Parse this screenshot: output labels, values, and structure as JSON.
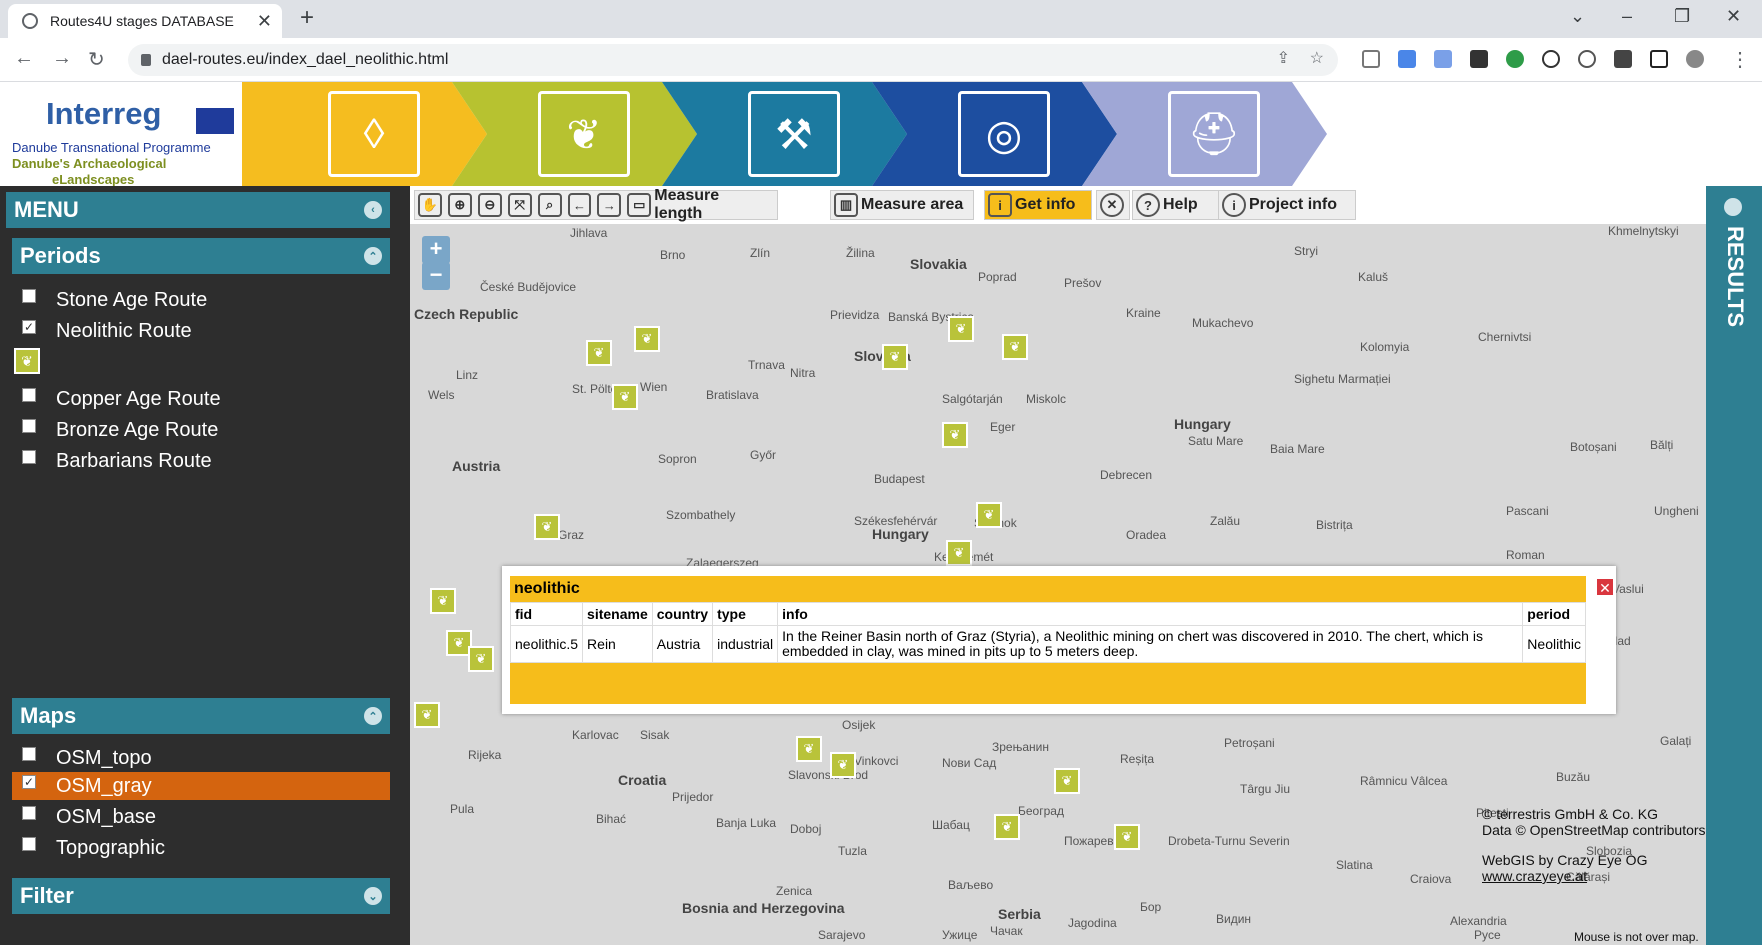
{
  "browser": {
    "tab_title": "Routes4U stages DATABASE",
    "url": "dael-routes.eu/index_dael_neolithic.html"
  },
  "banner": {
    "logo_brand": "Interreg",
    "logo_line1": "Danube Transnational Programme",
    "logo_line2": "Danube's Archaeological",
    "logo_line3": "eLandscapes",
    "chevrons": [
      {
        "icon": "stone-icon",
        "color": "#f5bd1f"
      },
      {
        "icon": "wheat-icon",
        "color": "#b7c230"
      },
      {
        "icon": "axe-icon",
        "color": "#1c7aa0"
      },
      {
        "icon": "spiral-icon",
        "color": "#1d4ea0"
      },
      {
        "icon": "helmet-icon",
        "color": "#9fa7d6"
      }
    ]
  },
  "menu": {
    "title": "MENU",
    "periods": {
      "title": "Periods",
      "items": [
        "Stone Age Route",
        "Neolithic Route",
        "Copper Age Route",
        "Bronze Age Route",
        "Barbarians Route"
      ]
    },
    "maps": {
      "title": "Maps",
      "items": [
        "OSM_topo",
        "OSM_gray",
        "OSM_base",
        "Topographic"
      ]
    },
    "filter_title": "Filter"
  },
  "toolbar": {
    "measure_length": "Measure length",
    "measure_area": "Measure area",
    "get_info": "Get info",
    "help": "Help",
    "project_info": "Project info"
  },
  "map_labels": [
    "Jihlava",
    "Brno",
    "Zlín",
    "Žilina",
    "Slovakia",
    "Poprad",
    "Prešov",
    "České Budějovice",
    "Czech Republic",
    "Banská Bystrica",
    "Prievidza",
    "Trnava",
    "Nitra",
    "Slovakia",
    "Linz",
    "Wien",
    "St. Pölten",
    "Bratislava",
    "Wels",
    "Salgótarján",
    "Miskolc",
    "Eger",
    "Hungary",
    "Satu Mare",
    "Baia Mare",
    "Austria",
    "Sopron",
    "Győr",
    "Budapest",
    "Debrecen",
    "Szombathely",
    "Székesfehérvár",
    "Szolnok",
    "Hungary",
    "Oradea",
    "Zalău",
    "Bistrița",
    "Graz",
    "Kecskemét",
    "Zalaegerszeg",
    "Croatia",
    "Karlovac",
    "Sisak",
    "Rijeka",
    "Prijedor",
    "Osijek",
    "Nови Сад",
    "Зрењанин",
    "Reșița",
    "Petroșani",
    "Târgu Jiu",
    "Râmnicu Vâlcea",
    "Pitești",
    "Bihać",
    "Banja Luka",
    "Doboj",
    "Tuzla",
    "Шабац",
    "Београд",
    "Пожаревац",
    "Drobeta-Turnu Severin",
    "Slatina",
    "Craiova",
    "Bosnia and Herzegovina",
    "Zenica",
    "Ваљево",
    "Serbia",
    "Jagodina",
    "Бор",
    "Видин",
    "Pula",
    "Alexandria",
    "Sarajevo",
    "Ужице",
    "Чачак",
    "Pyce",
    "Roman",
    "Pascani",
    "Bârlad",
    "Galați",
    "Buzău",
    "Slobozia",
    "Călărași",
    "Vaslui",
    "Botoșani",
    "Bălți",
    "Ungheni",
    "Chernivtsi",
    "Kolomyia",
    "Kraine",
    "Mukachevo",
    "Sighetu Marmației",
    "Slavonski Brod",
    "Vinkovci",
    "Stryi",
    "Kaluš",
    "Khmelnytskyi"
  ],
  "popup": {
    "title": "neolithic",
    "columns": [
      "fid",
      "sitename",
      "country",
      "type",
      "info",
      "period"
    ],
    "row": [
      "neolithic.5",
      "Rein",
      "Austria",
      "industrial",
      "In the Reiner Basin north of Graz (Styria), a Neolithic mining on chert was discovered in 2010. The chert, which is embedded in clay, was mined in pits up to 5 meters deep.",
      "Neolithic"
    ]
  },
  "credits": {
    "line1": "© terrestris GmbH & Co. KG",
    "line2": "Data © OpenStreetMap contributors",
    "line3": "WebGIS by Crazy Eye OG",
    "line4": "www.crazyeye.at",
    "mouse": "Mouse is not over map."
  },
  "results_label": "RESULTS"
}
